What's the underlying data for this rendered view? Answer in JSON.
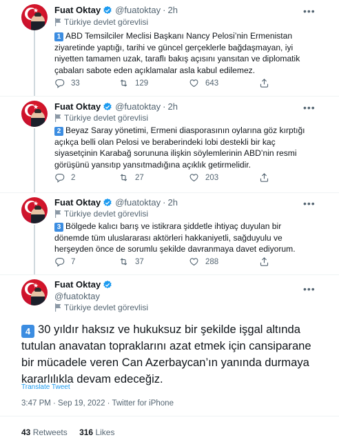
{
  "author": {
    "name": "Fuat Oktay",
    "handle": "@fuatoktay",
    "gov_label": "Türkiye devlet görevlisi"
  },
  "separator": "·",
  "tweets": [
    {
      "time": "2h",
      "number": "1",
      "text": "ABD Temsilciler Meclisi Başkanı Nancy Pelosi’nin Ermenistan ziyaretinde yaptığı, tarihi ve güncel gerçeklerle bağdaşmayan, iyi niyetten tamamen uzak, taraflı bakış açısını yansıtan ve diplomatik çabaları sabote eden açıklamalar asla kabul edilemez.",
      "replies": "33",
      "retweets": "129",
      "likes": "643"
    },
    {
      "time": "2h",
      "number": "2",
      "text": "Beyaz Saray yönetimi, Ermeni diasporasının oylarına göz kırptığı açıkça belli olan Pelosi ve beraberindeki lobi destekli bir kaç siyasetçinin Karabağ sorununa ilişkin söylemlerinin ABD’nin resmi görüşünü yansıtıp yansıtmadığına açıklık getirmelidir.",
      "replies": "2",
      "retweets": "27",
      "likes": "203"
    },
    {
      "time": "2h",
      "number": "3",
      "text": "Bölgede kalıcı barış ve istikrara şiddetle ihtiyaç duyulan bir dönemde tüm uluslararası aktörleri hakkaniyetli, sağduyulu ve herşeyden önce de sorumlu şekilde davranmaya davet ediyorum.",
      "replies": "7",
      "retweets": "37",
      "likes": "288"
    }
  ],
  "main_tweet": {
    "number": "4",
    "text": "30 yıldır haksız ve hukuksuz bir şekilde işgal altında tutulan anavatan topraklarını azat etmek için cansiparane bir mücadele veren Can Azerbaycan’ın yanında durmaya kararlılıkla devam edeceğiz.",
    "translate": "Translate Tweet",
    "timestamp": "3:47 PM · Sep 19, 2022 · Twitter for iPhone",
    "retweets_count": "43",
    "retweets_label": "Retweets",
    "likes_count": "316",
    "likes_label": "Likes"
  },
  "colors": {
    "accent": "#1d9bf0",
    "number_badge": "#3c8de1",
    "muted": "#536471"
  },
  "icons": [
    "verified-badge-icon",
    "more-icon",
    "turkey-flag-icon",
    "reply-icon",
    "retweet-icon",
    "like-icon"
  ]
}
